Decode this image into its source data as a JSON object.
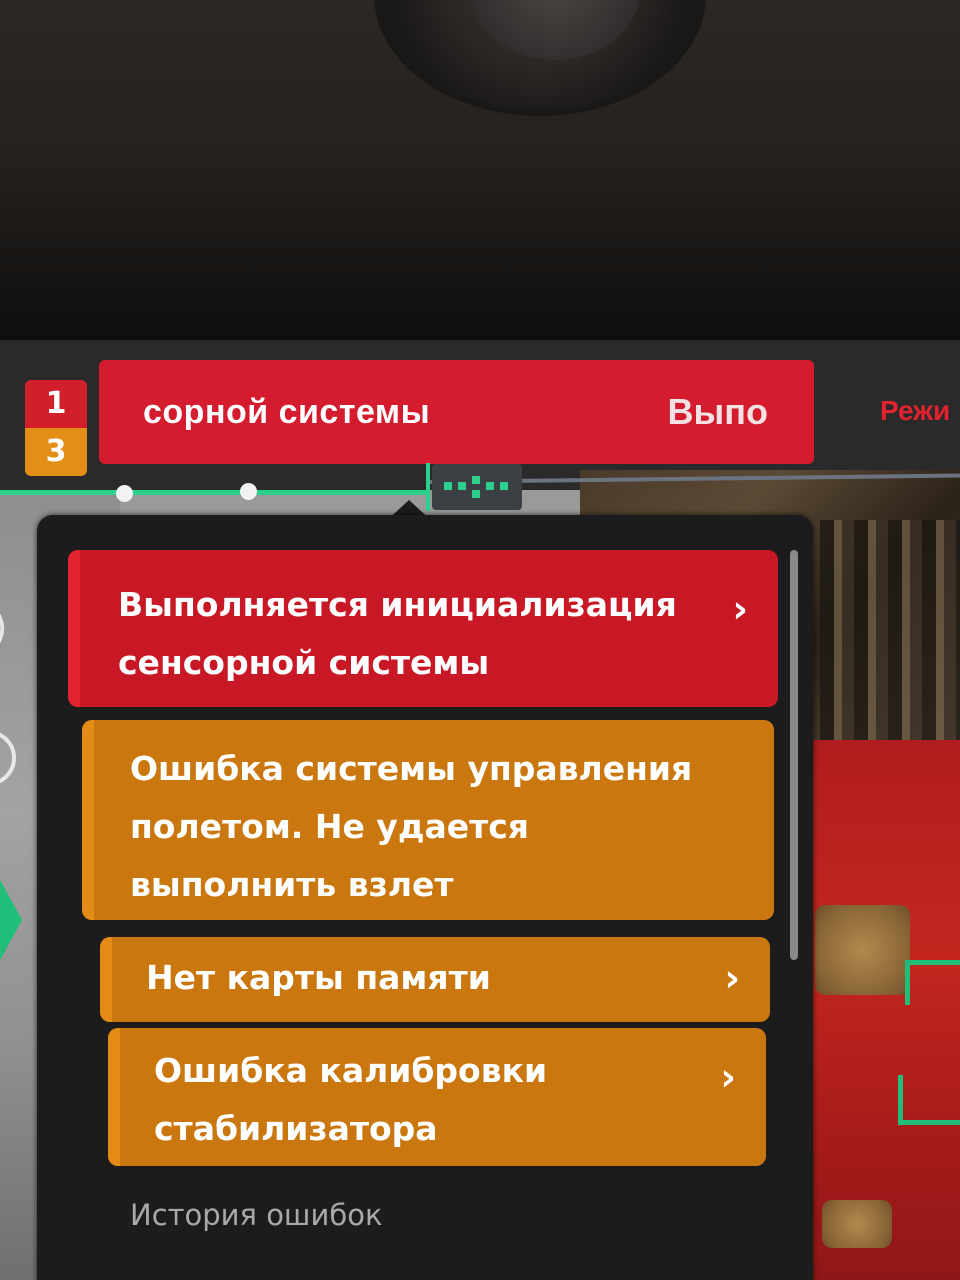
{
  "status_bar": {
    "counter_top": "1",
    "counter_bottom": "3",
    "alert_text": "сорной системы",
    "alert_action": "Выпо",
    "mode_label": "Режи"
  },
  "warnings_panel": {
    "items": [
      {
        "text": "Выполняется инициализация сенсорной системы",
        "severity": "error",
        "color": "#c81826",
        "has_chevron": true
      },
      {
        "text": "Ошибка системы управления полетом. Не удается выполнить взлет",
        "severity": "warning",
        "color": "#c9770e",
        "has_chevron": false
      },
      {
        "text": "Нет карты памяти",
        "severity": "warning",
        "color": "#c9770e",
        "has_chevron": true
      },
      {
        "text": "Ошибка калибровки стабилизатора",
        "severity": "warning",
        "color": "#c9770e",
        "has_chevron": true
      }
    ],
    "history_label": "История ошибок",
    "chevron_icon": "chevron-right-icon"
  },
  "colors": {
    "error": "#d41c2e",
    "warning": "#e38e16",
    "signal_green": "#2ccf8c"
  }
}
